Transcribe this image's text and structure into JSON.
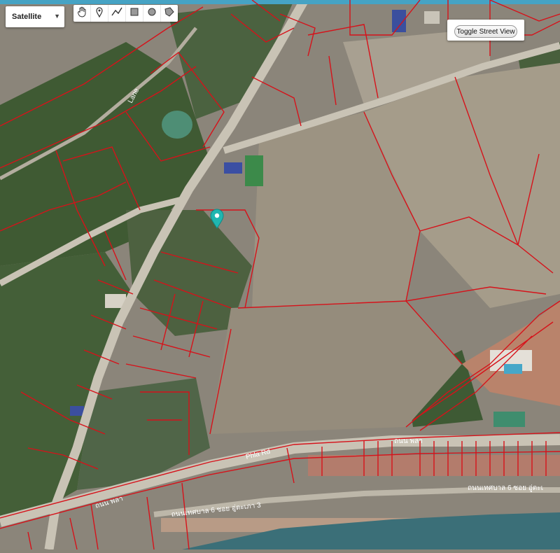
{
  "map_type": {
    "selected": "Satellite"
  },
  "toolbar": {
    "tools": [
      {
        "icon": "hand-pan-icon"
      },
      {
        "icon": "marker-pin-icon"
      },
      {
        "icon": "polyline-icon"
      },
      {
        "icon": "rectangle-icon"
      },
      {
        "icon": "circle-icon"
      },
      {
        "icon": "polygon-icon"
      }
    ]
  },
  "street_view": {
    "label": "Toggle Street View"
  },
  "labels": {
    "road_lane": "Lane",
    "road_phla": "Phla Rd",
    "road_thai_1": "ถนน พลา",
    "road_thai_2": "ถนน พลา",
    "road_thai_3": "ถนนเทศบาล 6 ซอย อู่ตะเภา 3",
    "road_thai_4": "ถนนเทศบาล 6 ซอย อู่ตะเ"
  },
  "colors": {
    "parcel_line": "#d6121a",
    "marker": "#20b6b0",
    "road": "#c8c2b4",
    "sea": "#3b6f78"
  }
}
